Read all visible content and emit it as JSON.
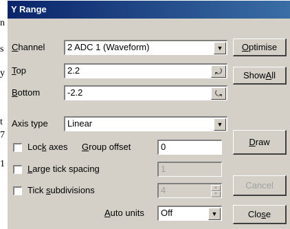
{
  "background_letters": [
    "n",
    "s",
    "y",
    "t",
    "7",
    "1"
  ],
  "dialog": {
    "title": "Y Range",
    "channel": {
      "label": "Channel",
      "value": "2 ADC 1 (Waveform)"
    },
    "top": {
      "label": "Top",
      "value": "2.2"
    },
    "bottom": {
      "label": "Bottom",
      "value": "-2.2"
    },
    "axis_type": {
      "label": "Axis type",
      "value": "Linear"
    },
    "lock_axes": {
      "label": "Lock axes",
      "checked": false
    },
    "group_offset": {
      "label": "Group offset",
      "value": "0"
    },
    "large_tick": {
      "label": "Large tick spacing",
      "checked": false,
      "value": "1"
    },
    "tick_subdivisions": {
      "label": "Tick subdivisions",
      "checked": false,
      "value": "4"
    },
    "auto_units": {
      "label": "Auto units",
      "value": "Off"
    },
    "buttons": {
      "optimise": "Optimise",
      "show_all": "Show All",
      "draw": "Draw",
      "cancel": "Cancel",
      "close": "Close"
    }
  }
}
